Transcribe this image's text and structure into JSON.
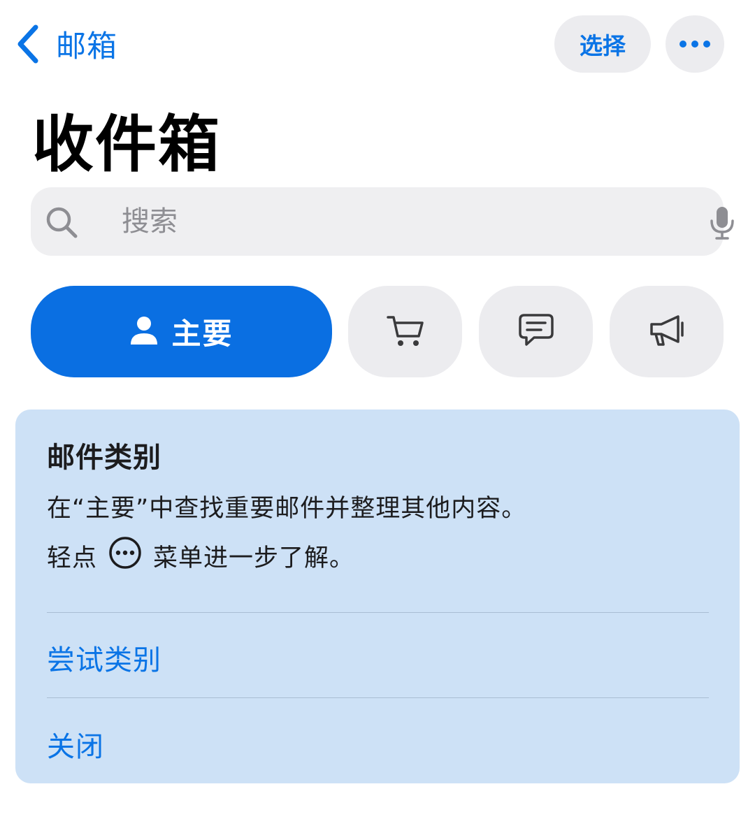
{
  "nav": {
    "back_label": "邮箱",
    "select_label": "选择"
  },
  "title": "收件箱",
  "search": {
    "placeholder": "搜索"
  },
  "tabs": [
    {
      "label": "主要",
      "icon": "person-icon",
      "selected": true
    },
    {
      "icon": "cart-icon",
      "selected": false
    },
    {
      "icon": "chat-bubble-icon",
      "selected": false
    },
    {
      "icon": "megaphone-icon",
      "selected": false
    }
  ],
  "card": {
    "title": "邮件类别",
    "description": "在“主要”中查找重要邮件并整理其他内容。",
    "hint_before": "轻点",
    "hint_icon": "ellipsis-circle-icon",
    "hint_after": "菜单进一步了解。",
    "try_label": "尝试类别",
    "close_label": "关闭"
  },
  "colors": {
    "accent": "#0a74e6",
    "tab_selected": "#0a6fe2",
    "card_background": "#cde1f6",
    "pill_background": "#ececef"
  }
}
